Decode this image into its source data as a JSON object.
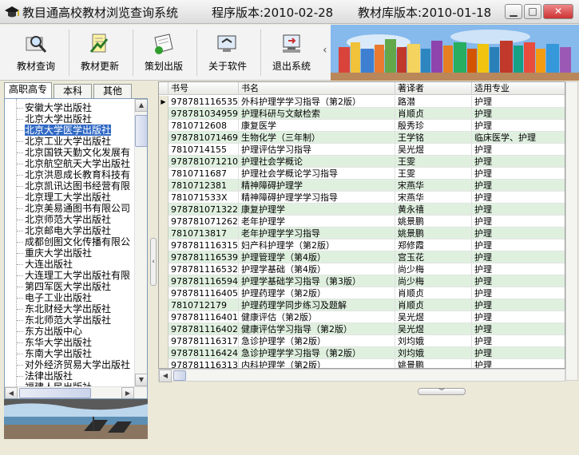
{
  "window": {
    "title": "教目通高校教材浏览查询系统",
    "program_version": "程序版本:2010-02-28",
    "db_version": "教材库版本:2010-01-18",
    "btn_min": "▁",
    "btn_max": "□",
    "btn_close": "✕"
  },
  "toolbar": {
    "items": [
      {
        "label": "教材查询",
        "icon": "search-book-icon"
      },
      {
        "label": "教材更新",
        "icon": "update-book-icon"
      },
      {
        "label": "策划出版",
        "icon": "plan-publish-icon"
      },
      {
        "label": "关于软件",
        "icon": "about-icon"
      },
      {
        "label": "退出系统",
        "icon": "exit-icon"
      }
    ],
    "arrow": "‹"
  },
  "tabs": [
    "高职高专",
    "本科",
    "其他"
  ],
  "tree": {
    "items": [
      "安徽大学出版社",
      "北京大学出版社",
      "北京大学医学出版社",
      "北京工业大学出版社",
      "北京国铁天勤文化发展有",
      "北京航空航天大学出版社",
      "北京洪恩成长教育科技有",
      "北京凯讯达图书经营有限",
      "北京理工大学出版社",
      "北京美易通图书有限公司",
      "北京师范大学出版社",
      "北京邮电大学出版社",
      "成都创图文化传播有限公",
      "重庆大学出版社",
      "大连出版社",
      "大连理工大学出版社有限",
      "第四军医大学出版社",
      "电子工业出版社",
      "东北财经大学出版社",
      "东北师范大学出版社",
      "东方出版中心",
      "东华大学出版社",
      "东南大学出版社",
      "对外经济贸易大学出版社",
      "法律出版社",
      "福建人民出版社"
    ],
    "selected_index": 2
  },
  "grid": {
    "columns": [
      "书号",
      "书名",
      "著译者",
      "适用专业"
    ],
    "rows": [
      [
        "9787811165357",
        "外科护理学学习指导（第2版）",
        "路潜",
        "护理"
      ],
      [
        "9787810349598",
        "护理科研与文献检索",
        "肖顺贞",
        "护理"
      ],
      [
        "781071260​8",
        "康复医学",
        "殷秀珍",
        "护理"
      ],
      [
        "9787810714693",
        "生物化学（三年制）",
        "王学铭",
        "临床医学、护理"
      ],
      [
        "781071415​5",
        "护理评估学习指导",
        "吴光煜",
        "护理"
      ],
      [
        "9787810712101",
        "护理社会学概论",
        "王雯",
        "护理"
      ],
      [
        "781071168​7",
        "护理社会学概论学习指导",
        "王雯",
        "护理"
      ],
      [
        "781071238​1",
        "精神障碍护理学",
        "宋燕华",
        "护理"
      ],
      [
        "781071533X",
        "精神障碍护理学学习指导",
        "宋燕华",
        "护理"
      ],
      [
        "9787810713221",
        "康复护理学",
        "黄永禧",
        "护理"
      ],
      [
        "9787810712620",
        "老年护理学",
        "姚景鹏",
        "护理"
      ],
      [
        "781071381​7",
        "老年护理学学习指导",
        "姚景鹏",
        "护理"
      ],
      [
        "9787811163155",
        "妇产科护理学（第2版）",
        "郑修霞",
        "护理"
      ],
      [
        "9787811165395",
        "护理管理学（第4版）",
        "宫玉花",
        "护理"
      ],
      [
        "9787811165326",
        "护理学基础（第4版）",
        "尚少梅",
        "护理"
      ],
      [
        "9787811165944",
        "护理学基础学习指导（第3版）",
        "尚少梅",
        "护理"
      ],
      [
        "9787811164053",
        "护理药理学（第2版）",
        "肖顺贞",
        "护理"
      ],
      [
        "781071217​9",
        "护理药理学同步练习及题解",
        "肖顺贞",
        "护理"
      ],
      [
        "9787811164015",
        "健康评估（第2版）",
        "吴光煜",
        "护理"
      ],
      [
        "9787811164022",
        "健康评估学习指导（第2版）",
        "吴光煜",
        "护理"
      ],
      [
        "9787811163179",
        "急诊护理学（第2版）",
        "刘均娥",
        "护理"
      ],
      [
        "9787811164244",
        "急诊护理学学习指导（第2版）",
        "刘均娥",
        "护理"
      ],
      [
        "9787811163131",
        "内科护理学（第2版）",
        "姚景鹏",
        "护理"
      ]
    ],
    "current_row_marker": "▶"
  },
  "colors": {
    "row_alt": "#dff0df",
    "selection": "#316ac5",
    "banner_sky": "#7fb3e8"
  }
}
